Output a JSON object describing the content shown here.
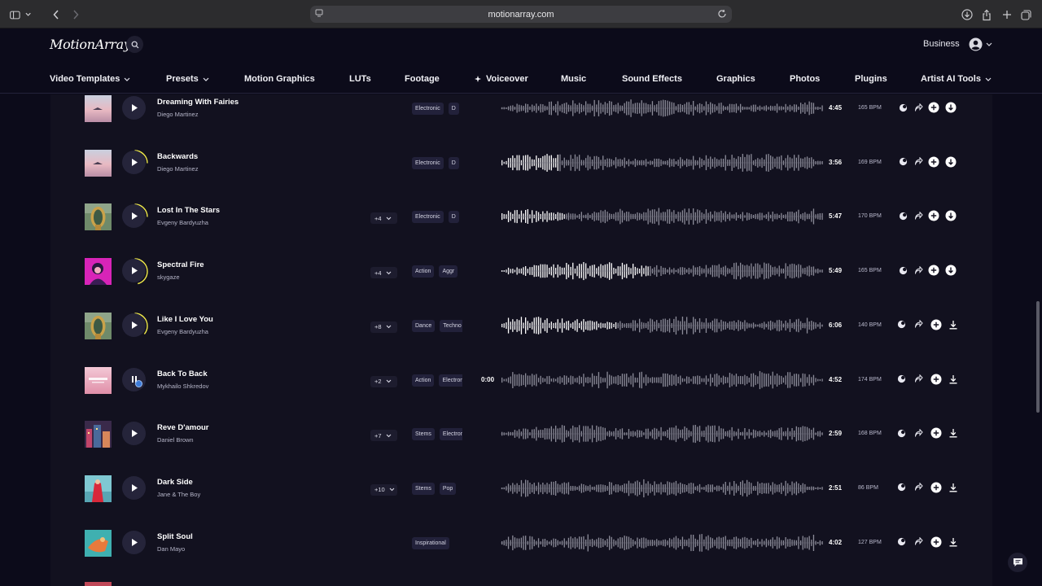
{
  "browser": {
    "url": "motionarray.com"
  },
  "header": {
    "logo": "MotionArray",
    "account_label": "Business",
    "nav": [
      {
        "label": "Video Templates",
        "dropdown": true
      },
      {
        "label": "Presets",
        "dropdown": true
      },
      {
        "label": "Motion Graphics",
        "dropdown": false
      },
      {
        "label": "LUTs",
        "dropdown": false
      },
      {
        "label": "Footage",
        "dropdown": false
      },
      {
        "label": "Voiceover",
        "dropdown": false,
        "sparkle": true
      },
      {
        "label": "Music",
        "dropdown": false
      },
      {
        "label": "Sound Effects",
        "dropdown": false
      },
      {
        "label": "Graphics",
        "dropdown": false
      },
      {
        "label": "Photos",
        "dropdown": false
      },
      {
        "label": "Plugins",
        "dropdown": false
      },
      {
        "label": "Artist AI Tools",
        "dropdown": true
      }
    ]
  },
  "tracks": [
    {
      "title": "Dreaming With Fairies",
      "artist": "Diego Martinez",
      "more": "",
      "tags": [
        "Electronic",
        "D"
      ],
      "elapsed": "",
      "duration": "4:45",
      "bpm": "165 BPM",
      "state": "idle",
      "progress": 0,
      "thumb": "pink-sky",
      "download_style": "filled"
    },
    {
      "title": "Backwards",
      "artist": "Diego Martinez",
      "more": "",
      "tags": [
        "Electronic",
        "D"
      ],
      "elapsed": "",
      "duration": "3:56",
      "bpm": "169 BPM",
      "state": "played",
      "progress": 0.18,
      "thumb": "pink-sky",
      "download_style": "filled"
    },
    {
      "title": "Lost In The Stars",
      "artist": "Evgeny Bardyuzha",
      "more": "+4",
      "tags": [
        "Electronic",
        "D"
      ],
      "elapsed": "",
      "duration": "5:47",
      "bpm": "170 BPM",
      "state": "played",
      "progress": 0.2,
      "thumb": "gold-portal",
      "download_style": "filled"
    },
    {
      "title": "Spectral Fire",
      "artist": "skygaze",
      "more": "+4",
      "tags": [
        "Action",
        "Aggr"
      ],
      "elapsed": "",
      "duration": "5:49",
      "bpm": "165 BPM",
      "state": "played",
      "progress": 0.46,
      "thumb": "magenta-girl",
      "download_style": "filled"
    },
    {
      "title": "Like I Love You",
      "artist": "Evgeny Bardyuzha",
      "more": "+8",
      "tags": [
        "Dance",
        "Techno"
      ],
      "elapsed": "",
      "duration": "6:06",
      "bpm": "140 BPM",
      "state": "played",
      "progress": 0.36,
      "thumb": "gold-portal",
      "download_style": "outline"
    },
    {
      "title": "Back To Back",
      "artist": "Mykhailo Shkredov",
      "more": "+2",
      "tags": [
        "Action",
        "Electronic"
      ],
      "elapsed": "0:00",
      "duration": "4:52",
      "bpm": "174 BPM",
      "state": "playing",
      "progress": 0,
      "thumb": "pink-text",
      "download_style": "outline"
    },
    {
      "title": "Reve D'amour",
      "artist": "Daniel Brown",
      "more": "+7",
      "tags": [
        "Stems",
        "Electronic"
      ],
      "elapsed": "",
      "duration": "2:59",
      "bpm": "168 BPM",
      "state": "idle",
      "progress": 0,
      "thumb": "city-night",
      "download_style": "outline"
    },
    {
      "title": "Dark Side",
      "artist": "Jane & The Boy",
      "more": "+10",
      "tags": [
        "Stems",
        "Pop"
      ],
      "elapsed": "",
      "duration": "2:51",
      "bpm": "86 BPM",
      "state": "idle",
      "progress": 0,
      "thumb": "red-dress",
      "download_style": "outline"
    },
    {
      "title": "Split Soul",
      "artist": "Dan Mayo",
      "more": "",
      "tags": [
        "Inspirational"
      ],
      "elapsed": "",
      "duration": "4:02",
      "bpm": "127 BPM",
      "state": "idle",
      "progress": 0,
      "thumb": "teal-orange",
      "download_style": "outline"
    }
  ],
  "colors": {
    "page_bg": "#0c0b1a",
    "list_bg": "#12111f",
    "accent_progress": "#f2ec4a",
    "played_wave": "#ffffff",
    "unplayed_wave": "#8c8c99",
    "cursor": "#3d7bd9"
  },
  "icons": [
    "sidebar-icon",
    "chevron-left-icon",
    "chevron-right-icon",
    "search-icon",
    "user-icon",
    "play-icon",
    "pause-icon",
    "favorite-icon",
    "share-icon",
    "add-icon",
    "download-icon",
    "chat-icon"
  ]
}
